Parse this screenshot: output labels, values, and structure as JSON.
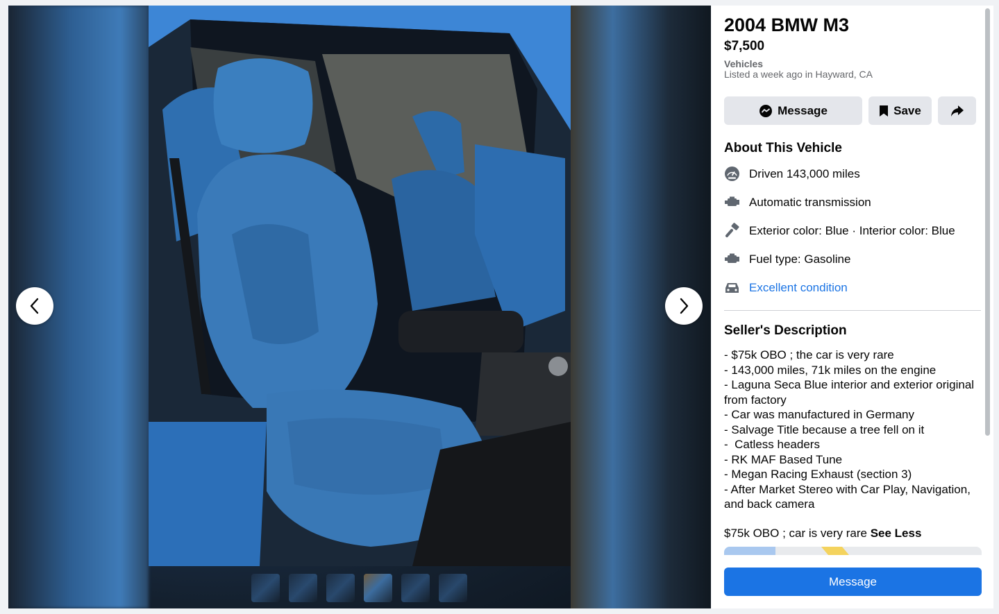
{
  "listing": {
    "title": "2004 BMW M3",
    "price": "$7,500",
    "category": "Vehicles",
    "listed": "Listed a week ago in Hayward, CA"
  },
  "actions": {
    "message_label": "Message",
    "save_label": "Save"
  },
  "about": {
    "title": "About This Vehicle",
    "items": [
      {
        "icon": "speedometer-icon",
        "text": "Driven 143,000 miles"
      },
      {
        "icon": "engine-icon",
        "text": "Automatic transmission"
      },
      {
        "icon": "paint-icon",
        "text": "Exterior color: Blue · Interior color: Blue"
      },
      {
        "icon": "engine-icon",
        "text": "Fuel type: Gasoline"
      },
      {
        "icon": "car-icon",
        "text": "Excellent condition"
      }
    ]
  },
  "seller": {
    "title": "Seller's Description",
    "lines": [
      "- $75k OBO ; the car is very rare",
      "- 143,000 miles, 71k miles on the engine",
      "- Laguna Seca Blue interior and exterior original from factory",
      "- Car was manufactured in Germany",
      "- Salvage Title because a tree fell on it",
      "-  Catless headers",
      "- RK MAF Based Tune",
      "- Megan Racing Exhaust (section 3)",
      "- After Market Stereo with Car Play, Navigation, and back camera"
    ],
    "summary": "$75k OBO ; car is very rare",
    "see_less": "See Less"
  },
  "bottom": {
    "message_label": "Message"
  },
  "colors": {
    "primary": "#1b74e4",
    "secondary_button": "#e4e6eb",
    "link": "#1b74e4"
  },
  "gallery": {
    "thumbnail_count": 6,
    "active_index": 3
  }
}
